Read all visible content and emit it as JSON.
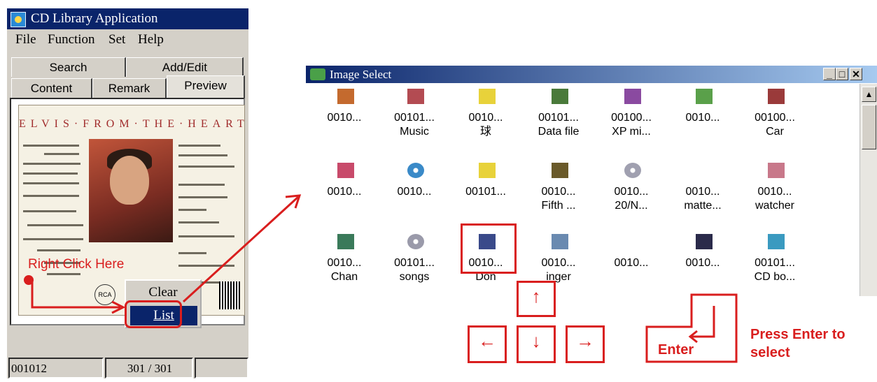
{
  "app_window": {
    "title": "CD Library Application",
    "menu": [
      "File",
      "Function",
      "Set",
      "Help"
    ],
    "tabs_row1": [
      "Search",
      "Add/Edit"
    ],
    "tabs_row2": [
      "Content",
      "Remark",
      "Preview"
    ],
    "album": {
      "header": "ELVIS·FROM·THE·HEART",
      "logo": "RCA"
    },
    "context_menu": [
      "Clear",
      "List"
    ],
    "status": {
      "code": "001012",
      "count": "301 / 301"
    }
  },
  "image_window": {
    "title": "Image Select",
    "items": [
      {
        "l1": "0010...",
        "l2": "",
        "color": "#c46a2e"
      },
      {
        "l1": "00101...",
        "l2": "Music",
        "color": "#b34b52"
      },
      {
        "l1": "0010...",
        "l2": "球",
        "color": "#e8d23a"
      },
      {
        "l1": "00101...",
        "l2": "Data file",
        "color": "#4a7a3a"
      },
      {
        "l1": "00100...",
        "l2": "XP mi...",
        "color": "#8a4aa0"
      },
      {
        "l1": "0010...",
        "l2": "",
        "color": "#5aa04a"
      },
      {
        "l1": "00100...",
        "l2": "Car",
        "color": "#9a3a3a"
      },
      {
        "l1": "0010...",
        "l2": "",
        "color": "#c84a6a"
      },
      {
        "l1": "0010...",
        "l2": "",
        "color": "#3a8ac8"
      },
      {
        "l1": "00101...",
        "l2": "",
        "color": "#e8d23a"
      },
      {
        "l1": "0010...",
        "l2": "Fifth ...",
        "color": "#6a5a2a"
      },
      {
        "l1": "0010...",
        "l2": "20/N...",
        "color": "#a0a0b0"
      },
      {
        "l1": "0010...",
        "l2": "matte...",
        "color": ""
      },
      {
        "l1": "0010...",
        "l2": "watcher",
        "color": "#c8788a"
      },
      {
        "l1": "0010...",
        "l2": "Chan",
        "color": "#3a7a5a"
      },
      {
        "l1": "00101...",
        "l2": "songs",
        "color": "#9a9aaa"
      },
      {
        "l1": "0010...",
        "l2": "Don",
        "color": "#3a4a8a"
      },
      {
        "l1": "0010...",
        "l2": "inger",
        "color": "#6a8ab0"
      },
      {
        "l1": "0010...",
        "l2": "",
        "color": ""
      },
      {
        "l1": "0010...",
        "l2": "",
        "color": "#2a2a4a"
      },
      {
        "l1": "00101...",
        "l2": "CD bo...",
        "color": "#3a9ac0"
      }
    ]
  },
  "annotations": {
    "right_click": "Right Click Here",
    "enter_key": "Enter",
    "press_enter": "Press Enter to select",
    "arrows": {
      "up": "↑",
      "left": "←",
      "down": "↓",
      "right": "→"
    }
  },
  "colors": {
    "annotation": "#d91e1e",
    "titlebar": "#0a246a",
    "face": "#d4d0c8"
  }
}
